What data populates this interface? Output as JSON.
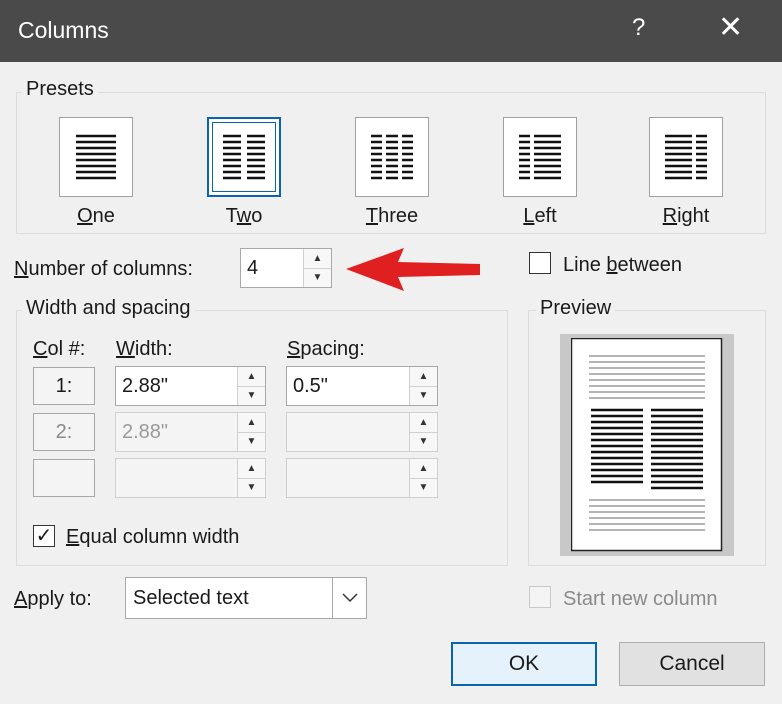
{
  "window": {
    "title": "Columns",
    "help": "?",
    "close": "✕"
  },
  "presets": {
    "legend": "Presets",
    "items": [
      {
        "label": "One",
        "key": "O",
        "rest": "ne",
        "pre": ""
      },
      {
        "label": "Two",
        "key": "w",
        "rest": "o",
        "pre": "T"
      },
      {
        "label": "Three",
        "key": "T",
        "rest": "hree",
        "pre": ""
      },
      {
        "label": "Left",
        "key": "L",
        "rest": "eft",
        "pre": ""
      },
      {
        "label": "Right",
        "key": "R",
        "rest": "ight",
        "pre": ""
      }
    ],
    "selected": "Two"
  },
  "num_columns": {
    "label_key": "N",
    "label_rest": "umber of columns:",
    "value": "4"
  },
  "line_between": {
    "pre": "Line ",
    "key": "b",
    "rest": "etween",
    "checked": false
  },
  "width_spacing": {
    "legend": "Width and spacing",
    "col_header_key": "C",
    "col_header_rest": "ol #:",
    "width_header_key": "W",
    "width_header_rest": "idth:",
    "spacing_header_key": "S",
    "spacing_header_rest": "pacing:",
    "rows": [
      {
        "col": "1:",
        "width": "2.88\"",
        "spacing": "0.5\""
      },
      {
        "col": "2:",
        "width": "2.88\"",
        "spacing": ""
      },
      {
        "col": "",
        "width": "",
        "spacing": ""
      }
    ]
  },
  "equal_width": {
    "key": "E",
    "rest": "qual column width",
    "checked": true,
    "check_glyph": "✓"
  },
  "preview": {
    "legend": "Preview"
  },
  "apply_to": {
    "label_key": "A",
    "label_rest": "pply to:",
    "value": "Selected text"
  },
  "start_new_column": {
    "label": "Start new column",
    "checked": false
  },
  "buttons": {
    "ok": "OK",
    "cancel": "Cancel"
  },
  "annotation": {
    "arrow_color": "#e02020"
  }
}
